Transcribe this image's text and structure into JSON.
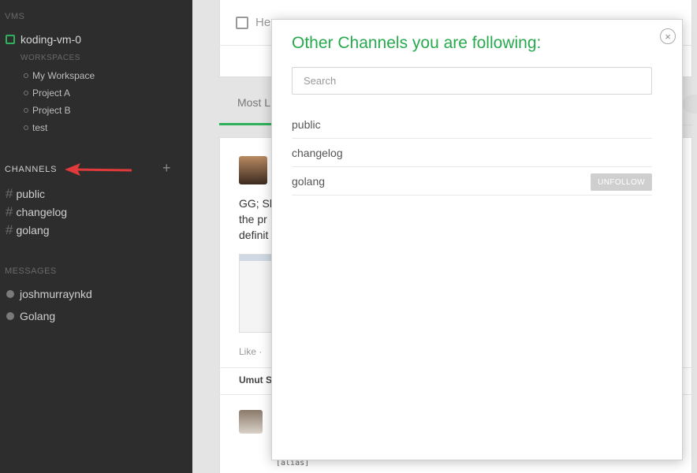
{
  "sidebar": {
    "vms_heading": "VMS",
    "vm_name": "koding-vm-0",
    "workspaces_heading": "WORKSPACES",
    "workspaces": [
      "My Workspace",
      "Project A",
      "Project B",
      "test"
    ],
    "channels_heading": "CHANNELS",
    "add_channel_icon": "+",
    "channels": [
      "public",
      "changelog",
      "golang"
    ],
    "messages_heading": "MESSAGES",
    "messages": [
      "joshmurraynkd",
      "Golang"
    ]
  },
  "main": {
    "compose_placeholder": "He",
    "tab_label": "Most L",
    "post_text_lines": [
      "GG; Sh",
      "the pr",
      "definit"
    ],
    "like_label": "Like  ·",
    "commenter": "Umut S",
    "code_snippet": "[alias]"
  },
  "modal": {
    "title": "Other Channels you are following:",
    "close_icon": "×",
    "search_placeholder": "Search",
    "channels": [
      {
        "name": "public",
        "action": ""
      },
      {
        "name": "changelog",
        "action": ""
      },
      {
        "name": "golang",
        "action": "UNFOLLOW"
      }
    ]
  },
  "colors": {
    "accent_green": "#27a94e",
    "sidebar_bg": "#2d2d2d",
    "arrow_red": "#e03a3a"
  },
  "icons": [
    "vm-status-icon",
    "workspace-dot-icon",
    "hash-icon",
    "plus-icon",
    "arrow-annotation-icon",
    "status-dot-icon",
    "compose-icon",
    "close-icon"
  ]
}
